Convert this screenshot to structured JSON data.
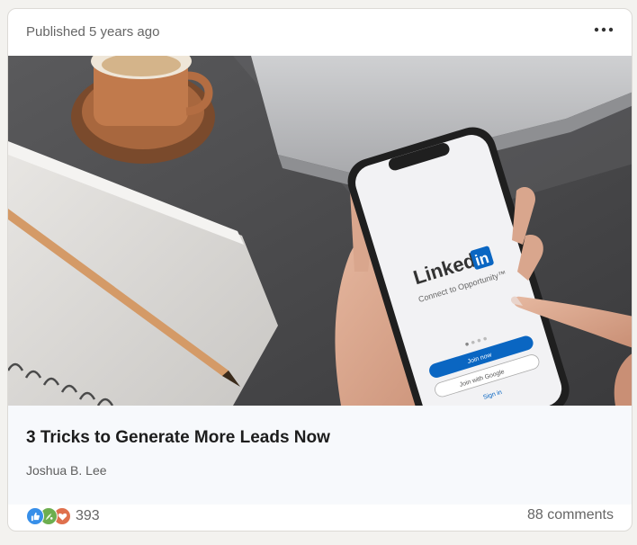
{
  "post": {
    "published": "Published 5 years ago",
    "title": "3 Tricks to Generate More Leads Now",
    "author": "Joshua B. Lee"
  },
  "image": {
    "phone_brand": "Linked",
    "phone_brand_in": "in",
    "phone_tagline": "Connect to Opportunity™",
    "phone_join_now": "Join now",
    "phone_join_google": "Join with Google",
    "phone_sign_in": "Sign in"
  },
  "social": {
    "reaction_count": "393",
    "comments": "88 comments",
    "reaction_icons": [
      "like-icon",
      "celebrate-icon",
      "love-icon"
    ]
  },
  "colors": {
    "like": "#378fe9",
    "celebrate": "#6dae4f",
    "love": "#df704d",
    "linkedin_blue": "#0a66c2"
  }
}
